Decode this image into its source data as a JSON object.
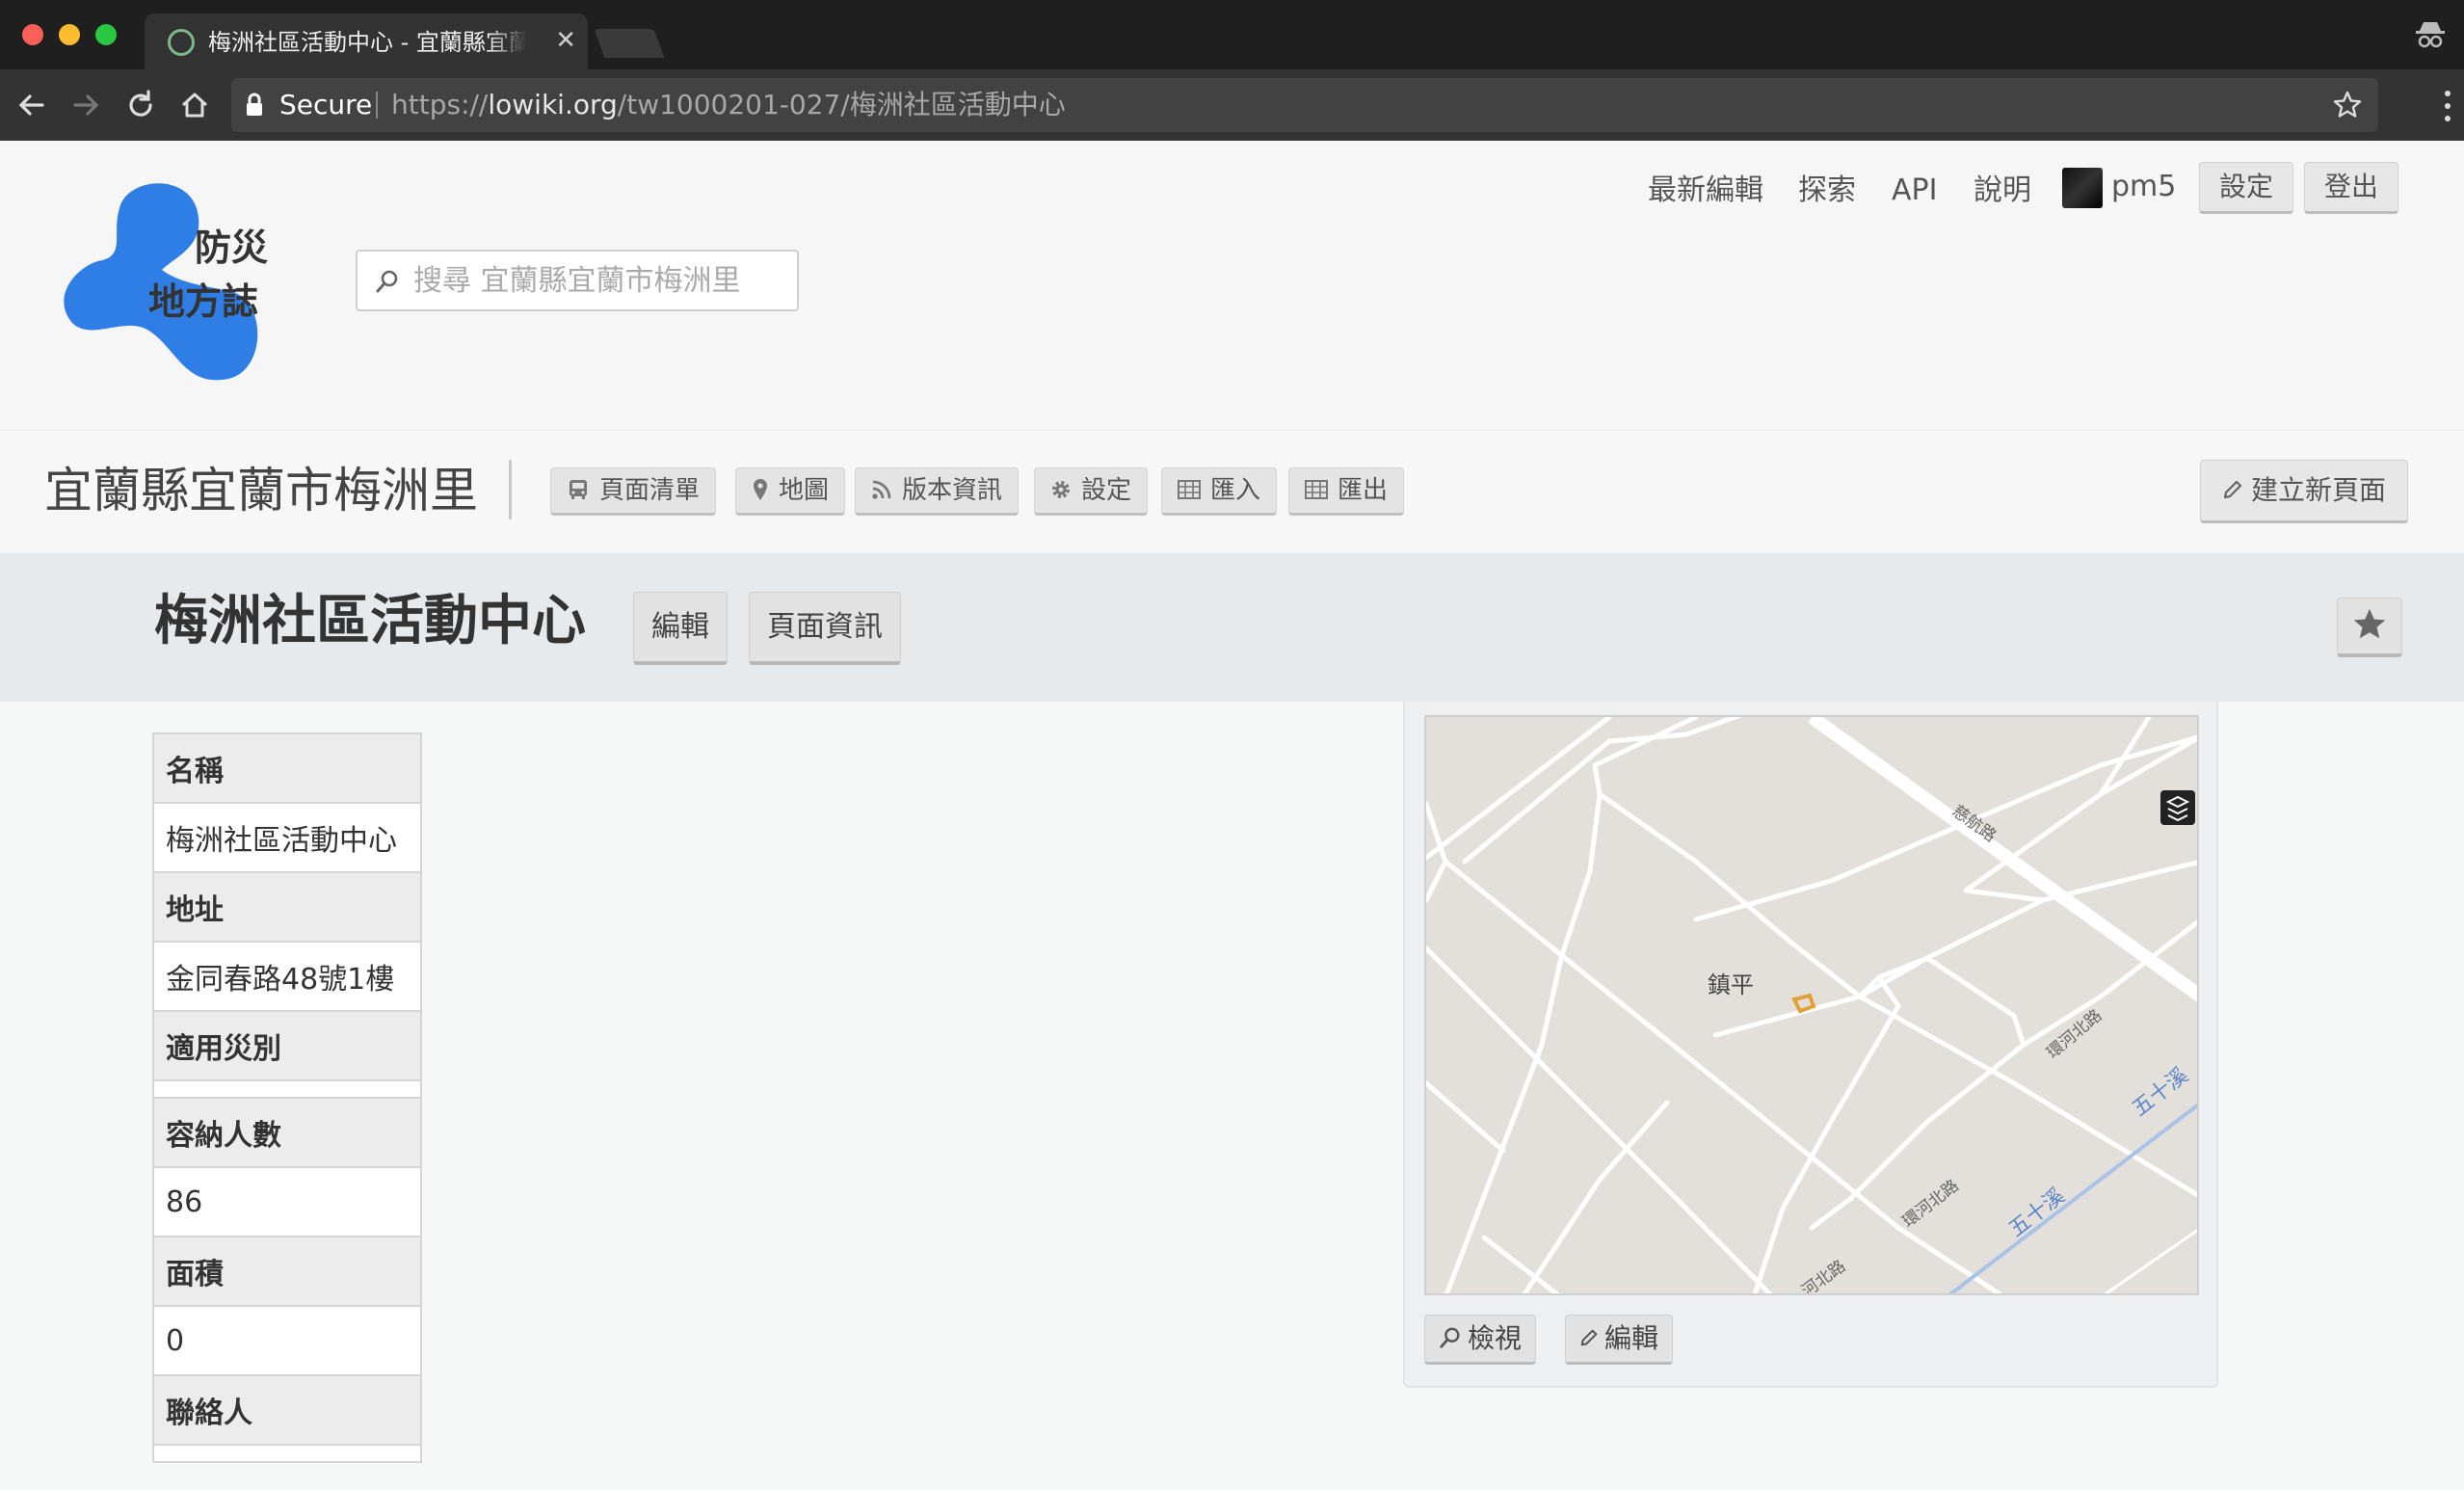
{
  "browser": {
    "tab_title": "梅洲社區活動中心 - 宜蘭縣宜蘭市梅洲里",
    "secure_label": "Secure",
    "url_scheme": "https://",
    "url_host": "lowiki.org",
    "url_path": "/tw1000201-027/梅洲社區活動中心",
    "traffic_colors": [
      "#fe5f57",
      "#febc2e",
      "#28c840"
    ]
  },
  "site": {
    "logo_line1": "防災",
    "logo_line2": "地方誌",
    "brand_color": "#2f7ee6",
    "search_placeholder": "搜尋 宜蘭縣宜蘭市梅洲里",
    "nav": {
      "recent_edits": "最新編輯",
      "explore": "探索",
      "api": "API",
      "help": "說明",
      "username": "pm5",
      "settings": "設定",
      "logout": "登出"
    }
  },
  "region": {
    "title": "宜蘭縣宜蘭市梅洲里",
    "buttons": {
      "page_list": "頁面清單",
      "map": "地圖",
      "changes": "版本資訊",
      "settings": "設定",
      "import": "匯入",
      "export": "匯出"
    },
    "create_page": "建立新頁面"
  },
  "page": {
    "title": "梅洲社區活動中心",
    "edit": "編輯",
    "info": "頁面資訊"
  },
  "info_table": {
    "name_label": "名稱",
    "name_value": "梅洲社區活動中心",
    "address_label": "地址",
    "address_value": "金同春路48號1樓",
    "disaster_label": "適用災別",
    "disaster_value": "",
    "capacity_label": "容納人數",
    "capacity_value": "86",
    "area_label": "面積",
    "area_value": "0",
    "contact_label": "聯絡人",
    "contact_value": ""
  },
  "map": {
    "place_label": "鎮平",
    "road_labels": [
      "慈航路",
      "環河北路",
      "環河北路",
      "河北路"
    ],
    "river_label": "五十溪",
    "view": "檢視",
    "edit": "編輯",
    "marker_color": "#e0a13a"
  }
}
